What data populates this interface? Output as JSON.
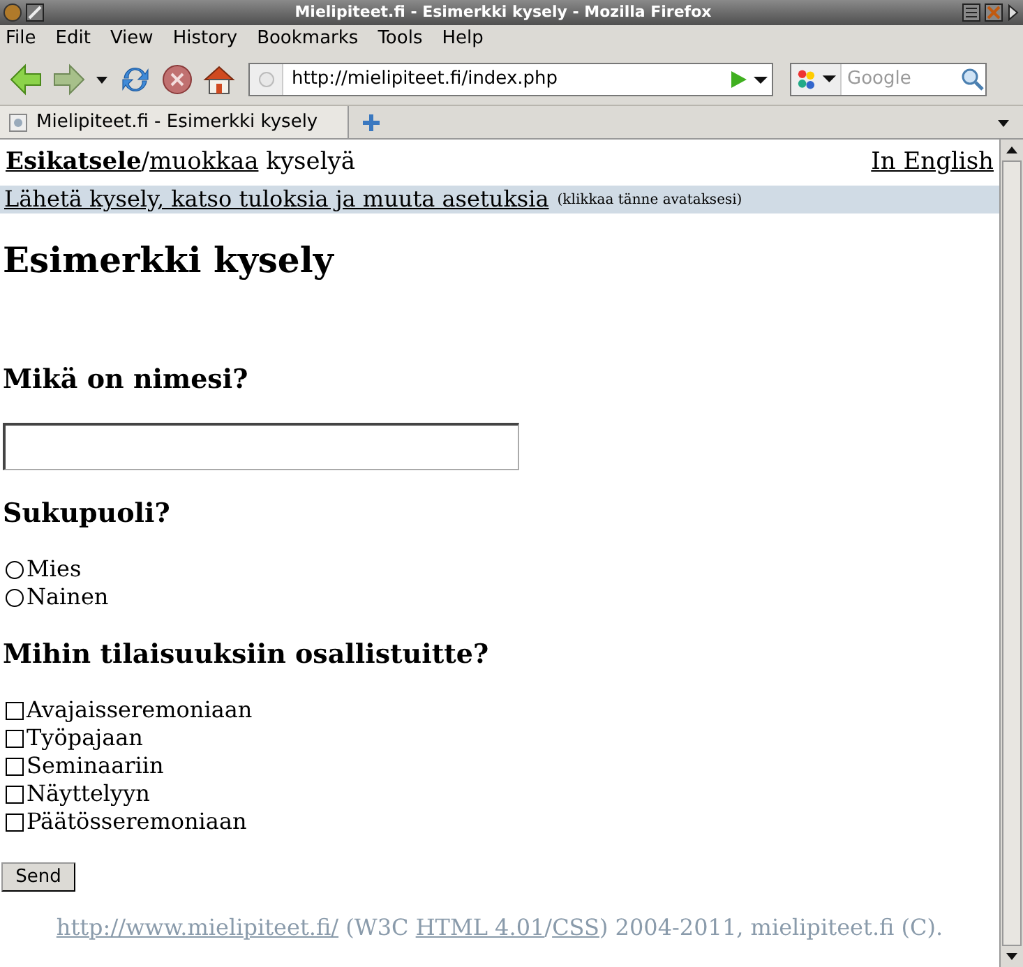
{
  "window": {
    "title": "Mielipiteet.fi - Esimerkki kysely - Mozilla Firefox"
  },
  "menu": [
    "File",
    "Edit",
    "View",
    "History",
    "Bookmarks",
    "Tools",
    "Help"
  ],
  "toolbar": {
    "url": "http://mielipiteet.fi/index.php",
    "search_placeholder": "Google"
  },
  "tabs": [
    {
      "label": "Mielipiteet.fi - Esimerkki kysely",
      "selected": true
    }
  ],
  "page": {
    "header": [
      {
        "kind": "strong_link",
        "text": "Esikatsele"
      },
      {
        "kind": "text",
        "text": "/"
      },
      {
        "kind": "link",
        "text": "muokkaa"
      },
      {
        "kind": "text",
        "text": " kyselyä"
      }
    ],
    "language_link": "In English",
    "settings_bar": {
      "link": "Lähetä kysely, katso tuloksia ja muuta asetuksia",
      "hint": "(klikkaa tänne avataksesi)"
    },
    "title": "Esimerkki kysely",
    "questions": [
      {
        "kind": "text",
        "label": "Mikä on nimesi?"
      },
      {
        "kind": "radio",
        "label": "Sukupuoli?",
        "options": [
          {
            "label": "Mies",
            "checked": false
          },
          {
            "label": "Nainen",
            "checked": false
          }
        ]
      },
      {
        "kind": "checkbox",
        "label": "Mihin tilaisuuksiin osallistuitte?",
        "options": [
          {
            "label": "Avajaisseremoniaan",
            "checked": false
          },
          {
            "label": "Työpajaan",
            "checked": false
          },
          {
            "label": "Seminaariin",
            "checked": false
          },
          {
            "label": "Näyttelyyn",
            "checked": false
          },
          {
            "label": "Päätösseremoniaan",
            "checked": false
          }
        ]
      }
    ],
    "submit": "Send",
    "footer": [
      {
        "kind": "link",
        "text": "http://www.mielipiteet.fi/"
      },
      {
        "kind": "text",
        "text": " (W3C "
      },
      {
        "kind": "link",
        "text": "HTML 4.01"
      },
      {
        "kind": "text",
        "text": "/"
      },
      {
        "kind": "link",
        "text": "CSS"
      },
      {
        "kind": "text",
        "text": ") 2004-2011, mielipiteet.fi (C)."
      }
    ]
  }
}
